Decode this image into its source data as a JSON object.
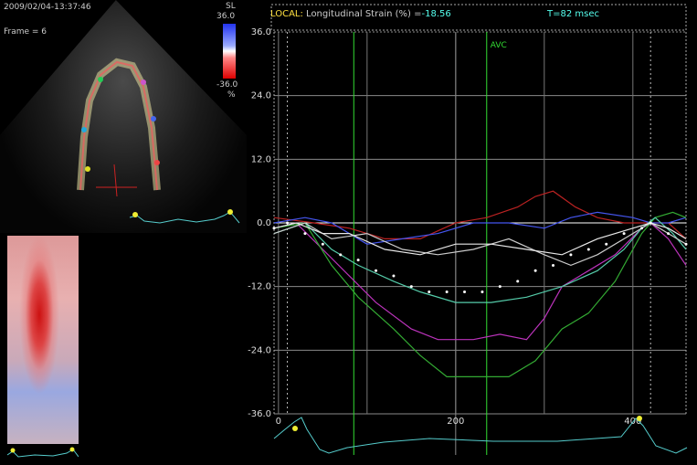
{
  "echo": {
    "timestamp": "2009/02/04-13:37:46",
    "frame_label": "Frame =  6",
    "colorbar_title": "SL",
    "colorbar_max": "36.0",
    "colorbar_min": "-36.0",
    "colorbar_unit": "%"
  },
  "header": {
    "mode": "LOCAL:",
    "label": "Longitudinal Strain (%) =",
    "value": "-18.56",
    "time": "T=82 msec"
  },
  "colors": {
    "background": "#000000",
    "grid": "#8a8a8a",
    "header_mode": "#ffe040",
    "header_value": "#55ffee",
    "avc_marker": "#33dd33"
  },
  "chart_data": {
    "type": "line",
    "ylim": [
      -36,
      36
    ],
    "xlim": [
      -5,
      460
    ],
    "yticks": [
      "36.0",
      "24.0",
      "12.0",
      "0.0",
      "-12.0",
      "-24.0",
      "-36.0"
    ],
    "ytick_values": [
      36,
      24,
      12,
      0,
      -12,
      -24,
      -36
    ],
    "xticks": [
      "0",
      "200",
      "400"
    ],
    "xtick_values": [
      0,
      200,
      400
    ],
    "avc": {
      "label": "AVC",
      "x": 235
    },
    "markers": [
      {
        "x": 85
      },
      {
        "x": 200
      },
      {
        "x": 235
      }
    ],
    "series": [
      {
        "color": "#bb2222",
        "values": [
          [
            -5,
            1
          ],
          [
            40,
            0
          ],
          [
            80,
            -1
          ],
          [
            120,
            -3
          ],
          [
            160,
            -3
          ],
          [
            200,
            0
          ],
          [
            235,
            1
          ],
          [
            270,
            3
          ],
          [
            290,
            5
          ],
          [
            310,
            6
          ],
          [
            335,
            3
          ],
          [
            360,
            1
          ],
          [
            390,
            0
          ],
          [
            420,
            0
          ],
          [
            440,
            0
          ],
          [
            460,
            -3
          ]
        ]
      },
      {
        "color": "#4455ee",
        "values": [
          [
            -5,
            0
          ],
          [
            30,
            1
          ],
          [
            60,
            0
          ],
          [
            100,
            -4
          ],
          [
            140,
            -3
          ],
          [
            180,
            -2
          ],
          [
            220,
            0
          ],
          [
            260,
            0
          ],
          [
            300,
            -1
          ],
          [
            330,
            1
          ],
          [
            360,
            2
          ],
          [
            400,
            1
          ],
          [
            420,
            0
          ],
          [
            440,
            0
          ],
          [
            460,
            1
          ]
        ]
      },
      {
        "color": "#bb33bb",
        "values": [
          [
            -5,
            -1
          ],
          [
            20,
            0
          ],
          [
            50,
            -5
          ],
          [
            80,
            -10
          ],
          [
            110,
            -15
          ],
          [
            150,
            -20
          ],
          [
            180,
            -22
          ],
          [
            220,
            -22
          ],
          [
            250,
            -21
          ],
          [
            280,
            -22
          ],
          [
            300,
            -18
          ],
          [
            320,
            -12
          ],
          [
            350,
            -9
          ],
          [
            380,
            -6
          ],
          [
            410,
            -1
          ],
          [
            420,
            0
          ],
          [
            440,
            -3
          ],
          [
            460,
            -8
          ]
        ]
      },
      {
        "color": "#33aa33",
        "values": [
          [
            -5,
            -1
          ],
          [
            30,
            0
          ],
          [
            60,
            -8
          ],
          [
            90,
            -14
          ],
          [
            130,
            -20
          ],
          [
            160,
            -25
          ],
          [
            190,
            -29
          ],
          [
            230,
            -29
          ],
          [
            260,
            -29
          ],
          [
            290,
            -26
          ],
          [
            320,
            -20
          ],
          [
            350,
            -17
          ],
          [
            380,
            -11
          ],
          [
            410,
            -2
          ],
          [
            425,
            1
          ],
          [
            445,
            2
          ],
          [
            460,
            1
          ]
        ]
      },
      {
        "color": "#55ccaa",
        "values": [
          [
            -5,
            -2
          ],
          [
            30,
            0
          ],
          [
            60,
            -5
          ],
          [
            90,
            -8
          ],
          [
            130,
            -11
          ],
          [
            160,
            -13
          ],
          [
            200,
            -15
          ],
          [
            240,
            -15
          ],
          [
            280,
            -14
          ],
          [
            320,
            -12
          ],
          [
            360,
            -9
          ],
          [
            390,
            -5
          ],
          [
            410,
            -1
          ],
          [
            425,
            1
          ],
          [
            445,
            -2
          ],
          [
            460,
            -5
          ]
        ]
      },
      {
        "color": "#cccccc",
        "values": [
          [
            -5,
            -2
          ],
          [
            30,
            0
          ],
          [
            60,
            -3
          ],
          [
            100,
            -2
          ],
          [
            140,
            -5
          ],
          [
            180,
            -6
          ],
          [
            220,
            -5
          ],
          [
            260,
            -3
          ],
          [
            300,
            -6
          ],
          [
            330,
            -8
          ],
          [
            360,
            -6
          ],
          [
            400,
            -2
          ],
          [
            420,
            0
          ],
          [
            440,
            -2
          ],
          [
            460,
            -4
          ]
        ]
      },
      {
        "color": "#e8e8e8",
        "values": [
          [
            -5,
            -1
          ],
          [
            20,
            0
          ],
          [
            50,
            -2
          ],
          [
            80,
            -2
          ],
          [
            120,
            -5
          ],
          [
            160,
            -6
          ],
          [
            200,
            -4
          ],
          [
            240,
            -4
          ],
          [
            280,
            -5
          ],
          [
            320,
            -6
          ],
          [
            360,
            -3
          ],
          [
            400,
            -1
          ],
          [
            420,
            0
          ],
          [
            440,
            -1
          ],
          [
            460,
            -3
          ]
        ]
      },
      {
        "color": "#ffffff",
        "style": "dotted",
        "values": [
          [
            -5,
            -1
          ],
          [
            10,
            0
          ],
          [
            30,
            -2
          ],
          [
            50,
            -4
          ],
          [
            70,
            -6
          ],
          [
            90,
            -7
          ],
          [
            110,
            -9
          ],
          [
            130,
            -10
          ],
          [
            150,
            -12
          ],
          [
            170,
            -13
          ],
          [
            190,
            -13
          ],
          [
            210,
            -13
          ],
          [
            230,
            -13
          ],
          [
            250,
            -12
          ],
          [
            270,
            -11
          ],
          [
            290,
            -9
          ],
          [
            310,
            -8
          ],
          [
            330,
            -6
          ],
          [
            350,
            -5
          ],
          [
            370,
            -4
          ],
          [
            390,
            -2
          ],
          [
            410,
            -1
          ],
          [
            420,
            0
          ],
          [
            440,
            -2
          ],
          [
            460,
            -4
          ]
        ]
      }
    ]
  }
}
